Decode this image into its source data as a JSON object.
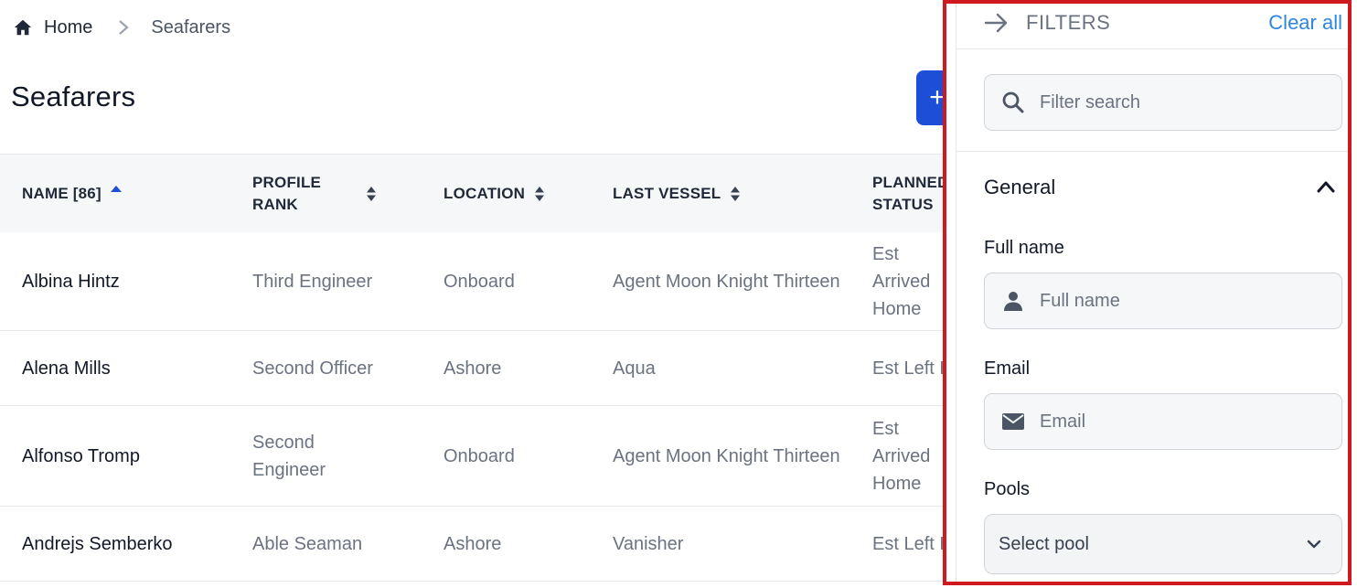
{
  "breadcrumb": {
    "home": "Home",
    "current": "Seafarers"
  },
  "page": {
    "title": "Seafarers",
    "add_label": "+"
  },
  "table": {
    "headers": {
      "name": "NAME [86]",
      "rank_line1": "PROFILE",
      "rank_line2": "RANK",
      "location": "LOCATION",
      "vessel": "LAST VESSEL",
      "status_line1": "PLANNED",
      "status_line2": "STATUS"
    },
    "rows": [
      {
        "name": "Albina Hintz",
        "rank": "Third Engineer",
        "location": "Onboard",
        "vessel": "Agent Moon Knight Thirteen",
        "status": "Est Arrived Home"
      },
      {
        "name": "Alena Mills",
        "rank": "Second Officer",
        "location": "Ashore",
        "vessel": "Aqua",
        "status": "Est Left Home"
      },
      {
        "name": "Alfonso Tromp",
        "rank": "Second Engineer",
        "location": "Onboard",
        "vessel": "Agent Moon Knight Thirteen",
        "status": "Est Arrived Home"
      },
      {
        "name": "Andrejs Semberko",
        "rank": "Able Seaman",
        "location": "Ashore",
        "vessel": "Vanisher",
        "status": "Est Left Home"
      }
    ]
  },
  "filters": {
    "title": "FILTERS",
    "clear_all": "Clear all",
    "search_placeholder": "Filter search",
    "section_general": "General",
    "full_name_label": "Full name",
    "full_name_placeholder": "Full name",
    "email_label": "Email",
    "email_placeholder": "Email",
    "pools_label": "Pools",
    "pools_select": "Select pool"
  },
  "colors": {
    "accent": "#1d4ed8",
    "link": "#2e86de",
    "highlight_border": "#d0191f"
  }
}
